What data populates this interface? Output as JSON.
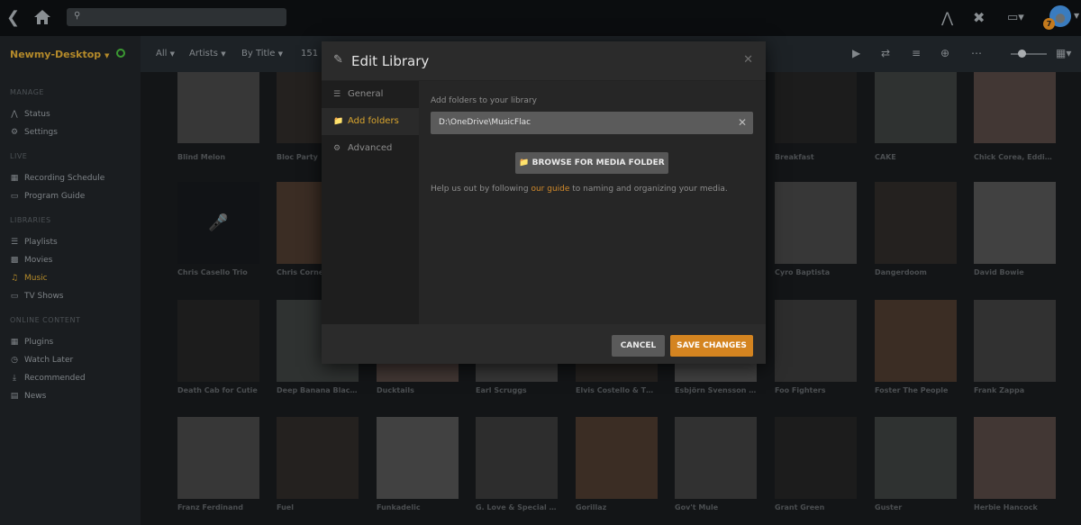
{
  "topbar": {
    "back_icon": "back-chevron-icon",
    "home_icon": "home-icon",
    "search_placeholder": "",
    "search_icon": "search-icon",
    "right_icons": [
      "activity-icon",
      "tools-icon",
      "cast-icon"
    ],
    "notification_count": "7"
  },
  "sidebar": {
    "server_name": "Newmy-Desktop",
    "sections": [
      {
        "title": "MANAGE",
        "items": [
          {
            "label": "Status",
            "icon": "status-icon"
          },
          {
            "label": "Settings",
            "icon": "gear-icon"
          }
        ]
      },
      {
        "title": "LIVE",
        "items": [
          {
            "label": "Recording Schedule",
            "icon": "calendar-icon"
          },
          {
            "label": "Program Guide",
            "icon": "tv-guide-icon"
          }
        ]
      },
      {
        "title": "LIBRARIES",
        "items": [
          {
            "label": "Playlists",
            "icon": "list-icon"
          },
          {
            "label": "Movies",
            "icon": "film-icon"
          },
          {
            "label": "Music",
            "icon": "music-icon",
            "active": true
          },
          {
            "label": "TV Shows",
            "icon": "tv-icon"
          }
        ]
      },
      {
        "title": "ONLINE CONTENT",
        "items": [
          {
            "label": "Plugins",
            "icon": "plugins-icon"
          },
          {
            "label": "Watch Later",
            "icon": "clock-icon"
          },
          {
            "label": "Recommended",
            "icon": "download-icon"
          },
          {
            "label": "News",
            "icon": "news-icon"
          }
        ]
      }
    ]
  },
  "toolbar": {
    "filters": [
      "All",
      "Artists",
      "By Title"
    ],
    "count": "151"
  },
  "artists": [
    [
      "Blind Melon",
      "Bloc Party",
      "",
      "",
      "",
      "",
      "Breakfast",
      "CAKE",
      "Chick Corea, Eddie ..."
    ],
    [
      "Chris Casello Trio",
      "Chris Corne",
      "",
      "",
      "",
      "",
      "Cyro Baptista",
      "Dangerdoom",
      "David Bowie"
    ],
    [
      "Death Cab for Cutie",
      "Deep Banana Black...",
      "Ducktails",
      "Earl Scruggs",
      "Elvis Costello & The...",
      "Esbjörn Svensson T...",
      "Foo Fighters",
      "Foster The People",
      "Frank Zappa"
    ],
    [
      "Franz Ferdinand",
      "Fuel",
      "Funkadelic",
      "G. Love & Special S...",
      "Gorillaz",
      "Gov't Mule",
      "Grant Green",
      "Guster",
      "Herbie Hancock"
    ]
  ],
  "modal": {
    "title": "Edit Library",
    "tabs": [
      {
        "label": "General",
        "icon": "general-icon"
      },
      {
        "label": "Add folders",
        "icon": "folder-icon",
        "active": true
      },
      {
        "label": "Advanced",
        "icon": "gear-icon"
      }
    ],
    "field_label": "Add folders to your library",
    "folder_path": "D:\\OneDrive\\MusicFlac",
    "browse_label": "BROWSE FOR MEDIA FOLDER",
    "help_prefix": "Help us out by following ",
    "help_link": "our guide",
    "help_suffix": " to naming and organizing your media.",
    "cancel_label": "CANCEL",
    "save_label": "SAVE CHANGES"
  },
  "colors": {
    "accent": "#d48420",
    "active_nav": "#b48a2a",
    "server_online": "#3b9a32"
  }
}
